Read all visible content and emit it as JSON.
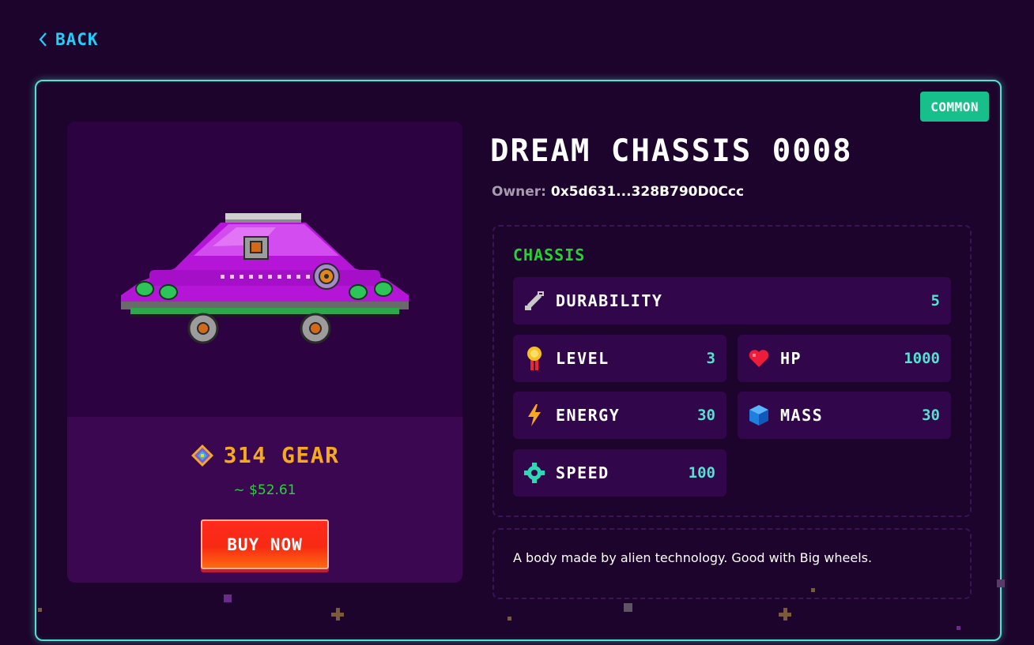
{
  "nav": {
    "back_label": "BACK"
  },
  "item": {
    "rarity": "COMMON",
    "title": "DREAM CHASSIS 0008",
    "owner_label": "Owner:",
    "owner_address": "0x5d631...328B790D0Ccc",
    "price_amount": "314 GEAR",
    "price_usd": "~ $52.61",
    "buy_label": "BUY NOW",
    "description": "A body made by alien technology. Good with Big wheels."
  },
  "stats": {
    "section_title": "CHASSIS",
    "durability": {
      "label": "DURABILITY",
      "value": "5",
      "icon": "wrench-icon"
    },
    "level": {
      "label": "LEVEL",
      "value": "3",
      "icon": "medal-icon"
    },
    "hp": {
      "label": "HP",
      "value": "1000",
      "icon": "heart-icon"
    },
    "energy": {
      "label": "ENERGY",
      "value": "30",
      "icon": "lightning-icon"
    },
    "mass": {
      "label": "MASS",
      "value": "30",
      "icon": "cube-icon"
    },
    "speed": {
      "label": "SPEED",
      "value": "100",
      "icon": "gear-icon"
    }
  },
  "colors": {
    "background": "#1d042c",
    "card_border": "#50e3d0",
    "rarity_badge": "#17c08b",
    "accent_cyan": "#50e3d0",
    "gear_gold": "#f6a821",
    "usd_green": "#25d53a",
    "buy_red": "#f72a12",
    "section_green": "#24d32f"
  }
}
